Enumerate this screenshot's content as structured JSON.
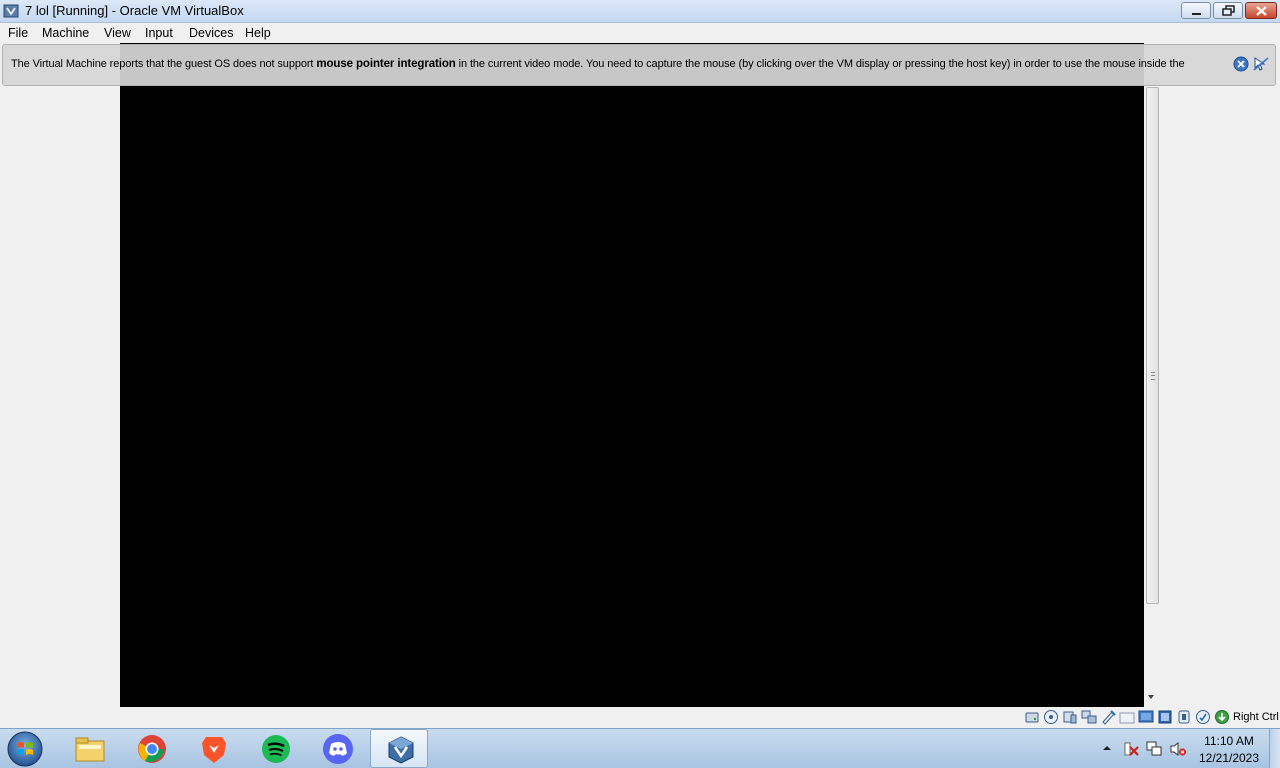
{
  "window": {
    "title": "7 lol [Running] - Oracle VM VirtualBox"
  },
  "menu": {
    "items": [
      "File",
      "Machine",
      "View",
      "Input",
      "Devices",
      "Help"
    ]
  },
  "notice": {
    "text_before": "The Virtual Machine reports that the guest OS does not support ",
    "text_bold": "mouse pointer integration",
    "text_after": " in the current video mode. You need to capture the mouse (by clicking over the VM display or pressing the host key) in order to use the mouse inside the",
    "close_icon": "close-icon",
    "mouse_icon": "mouse-integration-off-icon"
  },
  "statusbar": {
    "icons": [
      "hard-disk-icon",
      "optical-drive-icon",
      "audio-icon",
      "network-icon",
      "usb-icon",
      "shared-folders-icon",
      "display-icon",
      "video-capture-icon",
      "virtualization-icon",
      "mouse-integration-icon",
      "keyboard-capture-icon"
    ],
    "host_key": "Right Ctrl"
  },
  "taskbar": {
    "apps": [
      "file-explorer-icon",
      "chrome-icon",
      "brave-icon",
      "spotify-icon",
      "discord-icon",
      "virtualbox-icon"
    ],
    "active_app": "virtualbox-icon",
    "tray_icons": [
      "tray-overflow-icon",
      "action-center-icon",
      "network-tray-icon",
      "volume-muted-icon"
    ],
    "time": "11:10 AM",
    "date": "12/21/2023"
  },
  "colors": {
    "vm_screen": "#000000",
    "taskbar": "#b6cee8",
    "notice_bg": "#d6d6d6",
    "close_button": "#c9462c"
  }
}
